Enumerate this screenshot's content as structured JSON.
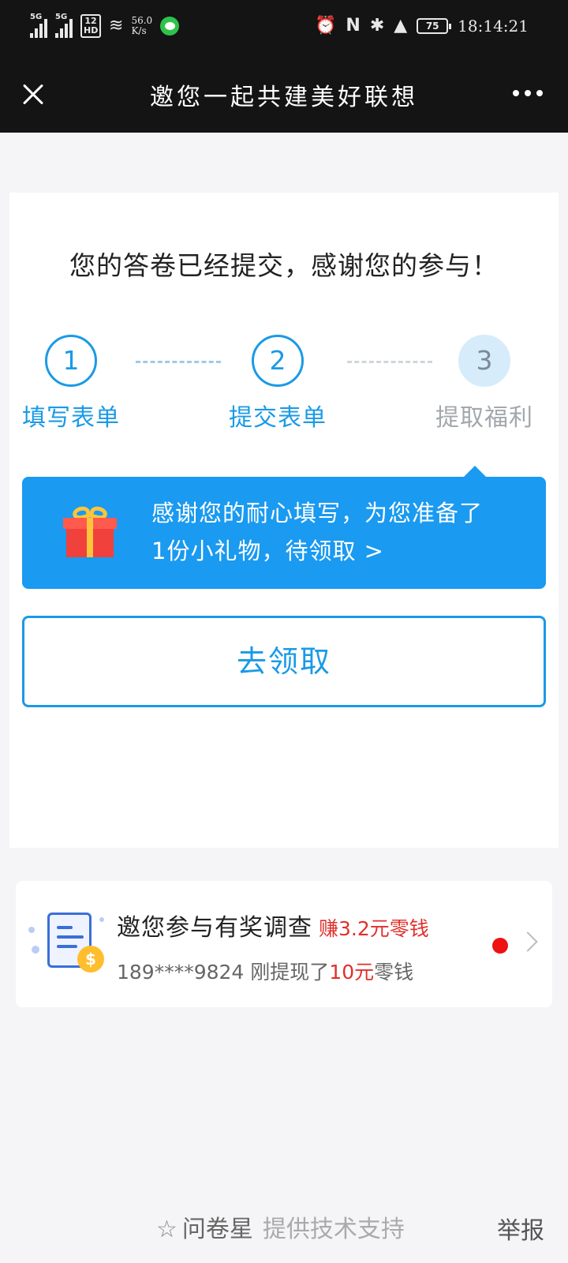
{
  "status_bar": {
    "signal1": "5G",
    "signal2": "5G",
    "hd": "1 2\nHD",
    "net_speed_value": "56.0",
    "net_speed_unit": "K/s",
    "battery": "75",
    "time": "18:14:21"
  },
  "nav": {
    "title": "邀您一起共建美好联想"
  },
  "survey": {
    "thanks": "您的答卷已经提交，感谢您的参与！",
    "steps": [
      {
        "number": "1",
        "label": "填写表单",
        "state": "done"
      },
      {
        "number": "2",
        "label": "提交表单",
        "state": "done"
      },
      {
        "number": "3",
        "label": "提取福利",
        "state": "current"
      }
    ],
    "gift_line1": "感谢您的耐心填写，为您准备了",
    "gift_line2": "1份小礼物，待领取 >",
    "claim_button": "去领取"
  },
  "promo": {
    "title": "邀您参与有奖调查",
    "earn": "赚3.2元零钱",
    "sub_prefix": "189****9824 刚提现了",
    "sub_amount": "10元",
    "sub_suffix": "零钱"
  },
  "footer": {
    "brand": "问卷星",
    "support": "提供技术支持",
    "report": "举报"
  },
  "colors": {
    "accent": "#1a9ae6",
    "bubble": "#1a9af0",
    "red": "#e0302c",
    "topbar": "#141414"
  }
}
